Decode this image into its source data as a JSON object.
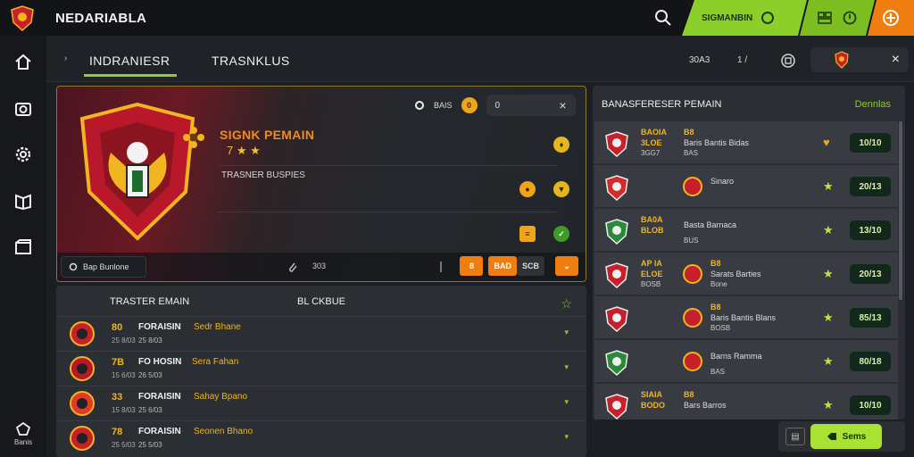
{
  "app": {
    "title": "NEDARIABLA"
  },
  "topbar": {
    "green_label": "SIGMANBIN"
  },
  "tabs": {
    "back": "›",
    "items": [
      {
        "label": "INDRANIESR",
        "active": true
      },
      {
        "label": "TRASNKLUS",
        "active": false
      }
    ],
    "right_a": "30A3",
    "right_b": "1 /",
    "close": "×"
  },
  "hero": {
    "title": "SIGNK PEMAIN",
    "stars": "7 ★ ★",
    "subtitle": "TRASNER BUSPIES",
    "toolbar_label": "BAIS",
    "coin_value": "0",
    "search_value": "0",
    "search_close": "×",
    "foot_button": "Bap Bunlone",
    "foot_mid_value": "303",
    "foot_btn_a": "8",
    "foot_btn_b": "BAD",
    "foot_btn_c": "SCB",
    "foot_btn_d": "⌄"
  },
  "transfer": {
    "title": "TRASTER EMAIN",
    "column": "BL CKBUE",
    "rows": [
      {
        "num": "80",
        "num2": "25 8/03",
        "name": "FORAISIN",
        "club": "Sedr Bhane",
        "sub": "25 8/03"
      },
      {
        "num": "7B",
        "num2": "15 6/03",
        "name": "FO HOSIN",
        "club": "Sera Fahan",
        "sub": "26 5/03"
      },
      {
        "num": "33",
        "num2": "15 8/03",
        "name": "FORAISIN",
        "club": "Sahay Bpano",
        "sub": "25 6/03"
      },
      {
        "num": "78",
        "num2": "25 5/03",
        "name": "FORAISIN",
        "club": "Seonen Bhano",
        "sub": "25 5/03"
      }
    ]
  },
  "right_panel": {
    "title": "BANASFERESER PEMAIN",
    "link": "Dennlas",
    "rows": [
      {
        "c1": "BAOIA",
        "c1b": "3LOE",
        "c1c": "3GG7",
        "d1": "B8",
        "d2": "Baris Bantis Bidas",
        "d3": "BAS",
        "price": "10/10",
        "badge": "trophy"
      },
      {
        "c1": "",
        "c1b": "",
        "c1c": "",
        "d1": "",
        "d2": "Sinaro",
        "d3": "",
        "price": "20/13",
        "badge": "star"
      },
      {
        "c1": "BA0A",
        "c1b": "BLOB",
        "c1c": "",
        "d1": "",
        "d2": "Basta Barnaca",
        "d3": "BUS",
        "price": "13/10",
        "badge": "star"
      },
      {
        "c1": "AP IA",
        "c1b": "ELOE",
        "c1c": "BOSB",
        "d1": "B8",
        "d2": "Sarats Barties",
        "d3": "Bone",
        "price": "20/13",
        "badge": "star"
      },
      {
        "c1": "",
        "c1b": "",
        "c1c": "",
        "d1": "B8",
        "d2": "Baris Bantis Blans",
        "d3": "BOSB",
        "price": "85/13",
        "badge": "star"
      },
      {
        "c1": "",
        "c1b": "",
        "c1c": "",
        "d1": "",
        "d2": "Barns Ramma",
        "d3": "BAS",
        "price": "80/18",
        "badge": "star"
      },
      {
        "c1": "SIAIA",
        "c1b": "BODO",
        "c1c": "",
        "d1": "B8",
        "d2": "Bars Barros",
        "d3": "",
        "price": "10/10",
        "badge": "star"
      }
    ]
  },
  "bottom_bar": {
    "button_label": "Sems"
  },
  "sidebar": {
    "bottom_label": "Banis"
  },
  "colors": {
    "accent_green": "#8ccf2a",
    "accent_orange": "#f07d10",
    "gold": "#f0b51f"
  }
}
